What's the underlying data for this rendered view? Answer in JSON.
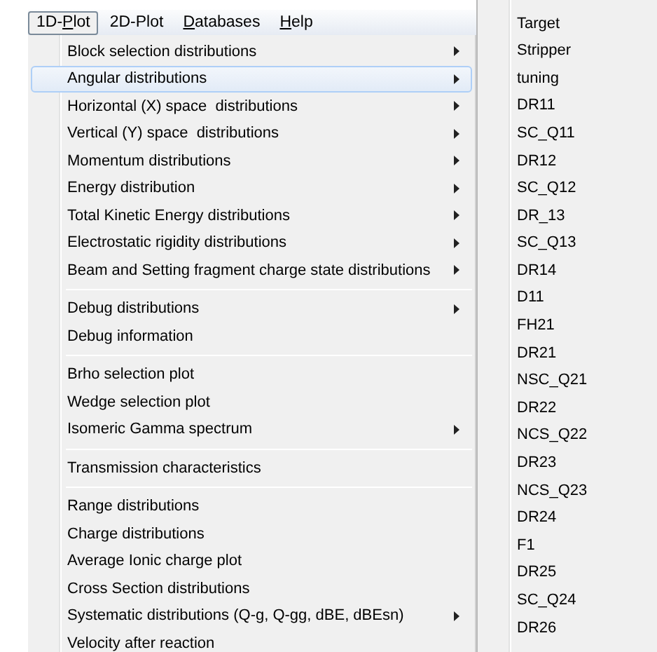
{
  "menubar": [
    {
      "parts": [
        {
          "text": "1D-"
        },
        {
          "text": "P",
          "underline": true
        },
        {
          "text": "lot"
        }
      ],
      "selected": true
    },
    {
      "parts": [
        {
          "text": "2D-Plot"
        }
      ],
      "selected": false
    },
    {
      "parts": [
        {
          "text": "D",
          "underline": true
        },
        {
          "text": "atabases"
        }
      ],
      "selected": false
    },
    {
      "parts": [
        {
          "text": "H",
          "underline": true
        },
        {
          "text": "elp"
        }
      ],
      "selected": false
    }
  ],
  "menu": [
    {
      "kind": "item",
      "label": "Block selection distributions",
      "submenu": true,
      "highlighted": false
    },
    {
      "kind": "item",
      "label": "Angular distributions",
      "submenu": true,
      "highlighted": true
    },
    {
      "kind": "item",
      "label": "Horizontal (X) space  distributions",
      "submenu": true,
      "highlighted": false
    },
    {
      "kind": "item",
      "label": "Vertical (Y) space  distributions",
      "submenu": true,
      "highlighted": false
    },
    {
      "kind": "item",
      "label": "Momentum distributions",
      "submenu": true,
      "highlighted": false
    },
    {
      "kind": "item",
      "label": "Energy distribution",
      "submenu": true,
      "highlighted": false
    },
    {
      "kind": "item",
      "label": "Total Kinetic Energy distributions",
      "submenu": true,
      "highlighted": false
    },
    {
      "kind": "item",
      "label": "Electrostatic rigidity distributions",
      "submenu": true,
      "highlighted": false
    },
    {
      "kind": "item",
      "label": "Beam and Setting fragment charge state distributions",
      "submenu": true,
      "highlighted": false
    },
    {
      "kind": "separator"
    },
    {
      "kind": "item",
      "label": "Debug distributions",
      "submenu": true,
      "highlighted": false
    },
    {
      "kind": "item",
      "label": "Debug information",
      "submenu": false,
      "highlighted": false
    },
    {
      "kind": "separator"
    },
    {
      "kind": "item",
      "label": "Brho selection plot",
      "submenu": false,
      "highlighted": false
    },
    {
      "kind": "item",
      "label": "Wedge selection plot",
      "submenu": false,
      "highlighted": false
    },
    {
      "kind": "item",
      "label": "Isomeric Gamma spectrum",
      "submenu": true,
      "highlighted": false
    },
    {
      "kind": "separator"
    },
    {
      "kind": "item",
      "label": "Transmission characteristics",
      "submenu": false,
      "highlighted": false
    },
    {
      "kind": "separator"
    },
    {
      "kind": "item",
      "label": "Range distributions",
      "submenu": false,
      "highlighted": false
    },
    {
      "kind": "item",
      "label": "Charge distributions",
      "submenu": false,
      "highlighted": false
    },
    {
      "kind": "item",
      "label": "Average Ionic charge plot",
      "submenu": false,
      "highlighted": false
    },
    {
      "kind": "item",
      "label": "Cross Section distributions",
      "submenu": false,
      "highlighted": false
    },
    {
      "kind": "item",
      "label": "Systematic distributions (Q-g, Q-gg, dBE, dBEsn)",
      "submenu": true,
      "highlighted": false
    },
    {
      "kind": "item",
      "label": "Velocity after reaction",
      "submenu": false,
      "highlighted": false
    }
  ],
  "submenu": [
    "Target",
    "Stripper",
    "tuning",
    "DR11",
    "SC_Q11",
    "DR12",
    "SC_Q12",
    "DR_13",
    "SC_Q13",
    "DR14",
    "D11",
    "FH21",
    "DR21",
    "NSC_Q21",
    "DR22",
    "NCS_Q22",
    "DR23",
    "NCS_Q23",
    "DR24",
    "F1",
    "DR25",
    "SC_Q24",
    "DR26"
  ]
}
